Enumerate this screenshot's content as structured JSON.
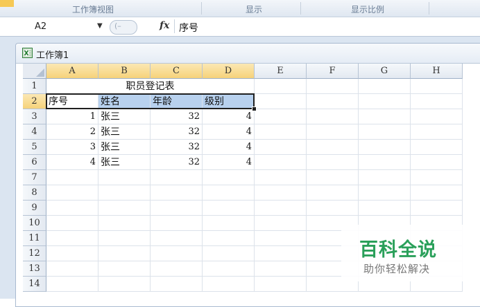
{
  "ribbon": {
    "groups": [
      "工作簿视图",
      "显示",
      "显示比例"
    ]
  },
  "formula_bar": {
    "cell_ref": "A2",
    "fx_label": "fx",
    "content": "序号"
  },
  "workbook": {
    "title": "工作簿1"
  },
  "sheet": {
    "columns": [
      "A",
      "B",
      "C",
      "D",
      "E",
      "F",
      "G",
      "H"
    ],
    "rows": [
      "1",
      "2",
      "3",
      "4",
      "5",
      "6",
      "7",
      "8",
      "9",
      "10",
      "11",
      "12",
      "13",
      "14"
    ],
    "title": "职员登记表",
    "header": [
      "序号",
      "姓名",
      "年龄",
      "级别"
    ],
    "data": [
      [
        "1",
        "张三",
        "32",
        "4"
      ],
      [
        "2",
        "张三",
        "32",
        "4"
      ],
      [
        "3",
        "张三",
        "32",
        "4"
      ],
      [
        "4",
        "张三",
        "32",
        "4"
      ]
    ]
  },
  "colors": {
    "selection_highlight": "#b8d1ee",
    "header_selected": "#f6d27a",
    "watermark_green": "#2aa05a"
  },
  "watermark": {
    "main": "百科全说",
    "sub": "助你轻松解决"
  }
}
